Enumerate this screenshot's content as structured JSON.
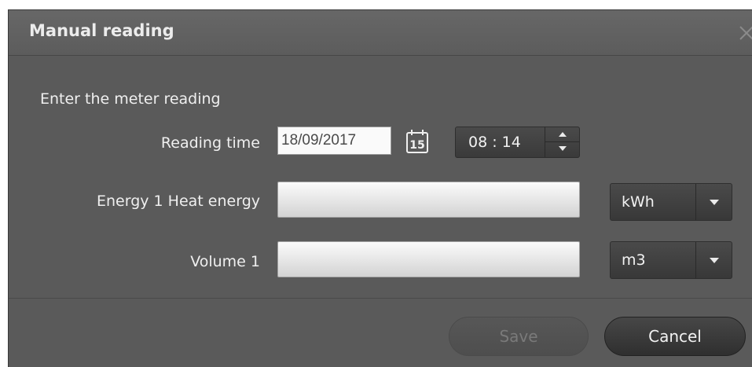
{
  "dialog": {
    "title": "Manual reading",
    "close_icon": "close-icon",
    "instruction": "Enter the meter reading"
  },
  "reading_time": {
    "label": "Reading time",
    "date": "18/09/2017",
    "calendar_icon": "calendar-icon",
    "calendar_day": "15",
    "time": "08 : 14"
  },
  "energy": {
    "label": "Energy 1 Heat energy",
    "value": "",
    "unit": "kWh"
  },
  "volume": {
    "label": "Volume 1",
    "value": "",
    "unit": "m3"
  },
  "buttons": {
    "save": "Save",
    "save_enabled": false,
    "cancel": "Cancel"
  }
}
